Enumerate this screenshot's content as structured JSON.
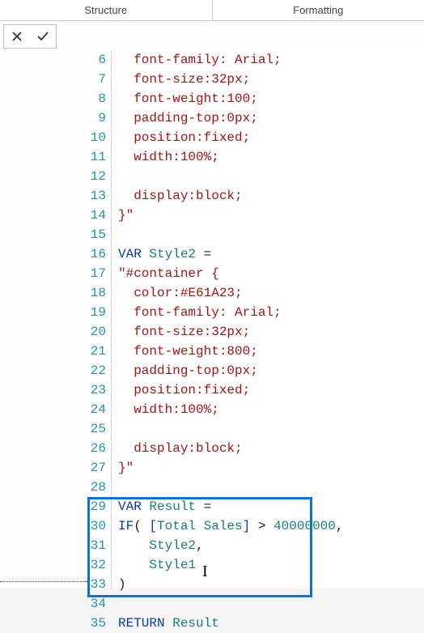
{
  "tabs": {
    "structure": "Structure",
    "formatting": "Formatting"
  },
  "code": {
    "lines": [
      {
        "n": 6,
        "segs": [
          [
            "  ",
            "plain"
          ],
          [
            "font-family: Arial;",
            "str"
          ]
        ]
      },
      {
        "n": 7,
        "segs": [
          [
            "  ",
            "plain"
          ],
          [
            "font-size:32px;",
            "str"
          ]
        ]
      },
      {
        "n": 8,
        "segs": [
          [
            "  ",
            "plain"
          ],
          [
            "font-weight:100;",
            "str"
          ]
        ]
      },
      {
        "n": 9,
        "segs": [
          [
            "  ",
            "plain"
          ],
          [
            "padding-top:0px;",
            "str"
          ]
        ]
      },
      {
        "n": 10,
        "segs": [
          [
            "  ",
            "plain"
          ],
          [
            "position:fixed;",
            "str"
          ]
        ]
      },
      {
        "n": 11,
        "segs": [
          [
            "  ",
            "plain"
          ],
          [
            "width:100%;",
            "str"
          ]
        ]
      },
      {
        "n": 12,
        "segs": []
      },
      {
        "n": 13,
        "segs": [
          [
            "  ",
            "plain"
          ],
          [
            "display:block;",
            "str"
          ]
        ]
      },
      {
        "n": 14,
        "segs": [
          [
            "}\"",
            "str"
          ]
        ]
      },
      {
        "n": 15,
        "segs": []
      },
      {
        "n": 16,
        "segs": [
          [
            "VAR",
            "kw"
          ],
          [
            " ",
            "plain"
          ],
          [
            "Style2",
            "id"
          ],
          [
            " =",
            "plain"
          ]
        ]
      },
      {
        "n": 17,
        "segs": [
          [
            "\"#container {",
            "str"
          ]
        ]
      },
      {
        "n": 18,
        "segs": [
          [
            "  ",
            "plain"
          ],
          [
            "color:#E61A23;",
            "str"
          ]
        ]
      },
      {
        "n": 19,
        "segs": [
          [
            "  ",
            "plain"
          ],
          [
            "font-family: Arial;",
            "str"
          ]
        ]
      },
      {
        "n": 20,
        "segs": [
          [
            "  ",
            "plain"
          ],
          [
            "font-size:32px;",
            "str"
          ]
        ]
      },
      {
        "n": 21,
        "segs": [
          [
            "  ",
            "plain"
          ],
          [
            "font-weight:800;",
            "str"
          ]
        ]
      },
      {
        "n": 22,
        "segs": [
          [
            "  ",
            "plain"
          ],
          [
            "padding-top:0px;",
            "str"
          ]
        ]
      },
      {
        "n": 23,
        "segs": [
          [
            "  ",
            "plain"
          ],
          [
            "position:fixed;",
            "str"
          ]
        ]
      },
      {
        "n": 24,
        "segs": [
          [
            "  ",
            "plain"
          ],
          [
            "width:100%;",
            "str"
          ]
        ]
      },
      {
        "n": 25,
        "segs": []
      },
      {
        "n": 26,
        "segs": [
          [
            "  ",
            "plain"
          ],
          [
            "display:block;",
            "str"
          ]
        ]
      },
      {
        "n": 27,
        "segs": [
          [
            "}\"",
            "str"
          ]
        ]
      },
      {
        "n": 28,
        "segs": []
      },
      {
        "n": 29,
        "segs": [
          [
            "VAR",
            "kw"
          ],
          [
            " ",
            "plain"
          ],
          [
            "Result",
            "id"
          ],
          [
            " =",
            "plain"
          ]
        ]
      },
      {
        "n": 30,
        "segs": [
          [
            "IF",
            "kw"
          ],
          [
            "( ",
            "plain"
          ],
          [
            "[",
            "brkt"
          ],
          [
            "Total Sales",
            "name"
          ],
          [
            "]",
            "brkt"
          ],
          [
            " > ",
            "plain"
          ],
          [
            "40000000",
            "num"
          ],
          [
            ",",
            "plain"
          ]
        ]
      },
      {
        "n": 31,
        "segs": [
          [
            "    ",
            "plain"
          ],
          [
            "Style2",
            "id"
          ],
          [
            ",",
            "plain"
          ]
        ]
      },
      {
        "n": 32,
        "segs": [
          [
            "    ",
            "plain"
          ],
          [
            "Style1",
            "id"
          ]
        ]
      },
      {
        "n": 33,
        "segs": [
          [
            ")",
            "plain"
          ]
        ]
      },
      {
        "n": 34,
        "segs": []
      },
      {
        "n": 35,
        "segs": [
          [
            "RETURN",
            "kw"
          ],
          [
            " ",
            "plain"
          ],
          [
            "Result",
            "id"
          ]
        ]
      }
    ]
  }
}
